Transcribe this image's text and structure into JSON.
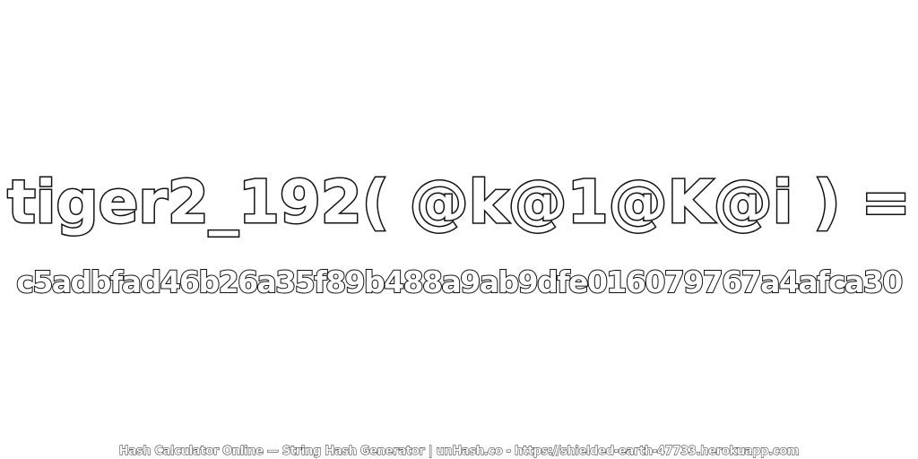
{
  "headline": "tiger2_192( @k@1@K@i ) =",
  "hash_value": "c5adbfad46b26a35f89b488a9ab9dfe016079767a4afca30",
  "footer": "Hash Calculator Online — String Hash Generator | unHash.co - https://shielded-earth-47733.herokuapp.com",
  "colors": {
    "background": "#ffffff",
    "text_fill": "#ffffff",
    "text_outline": "#111111"
  }
}
